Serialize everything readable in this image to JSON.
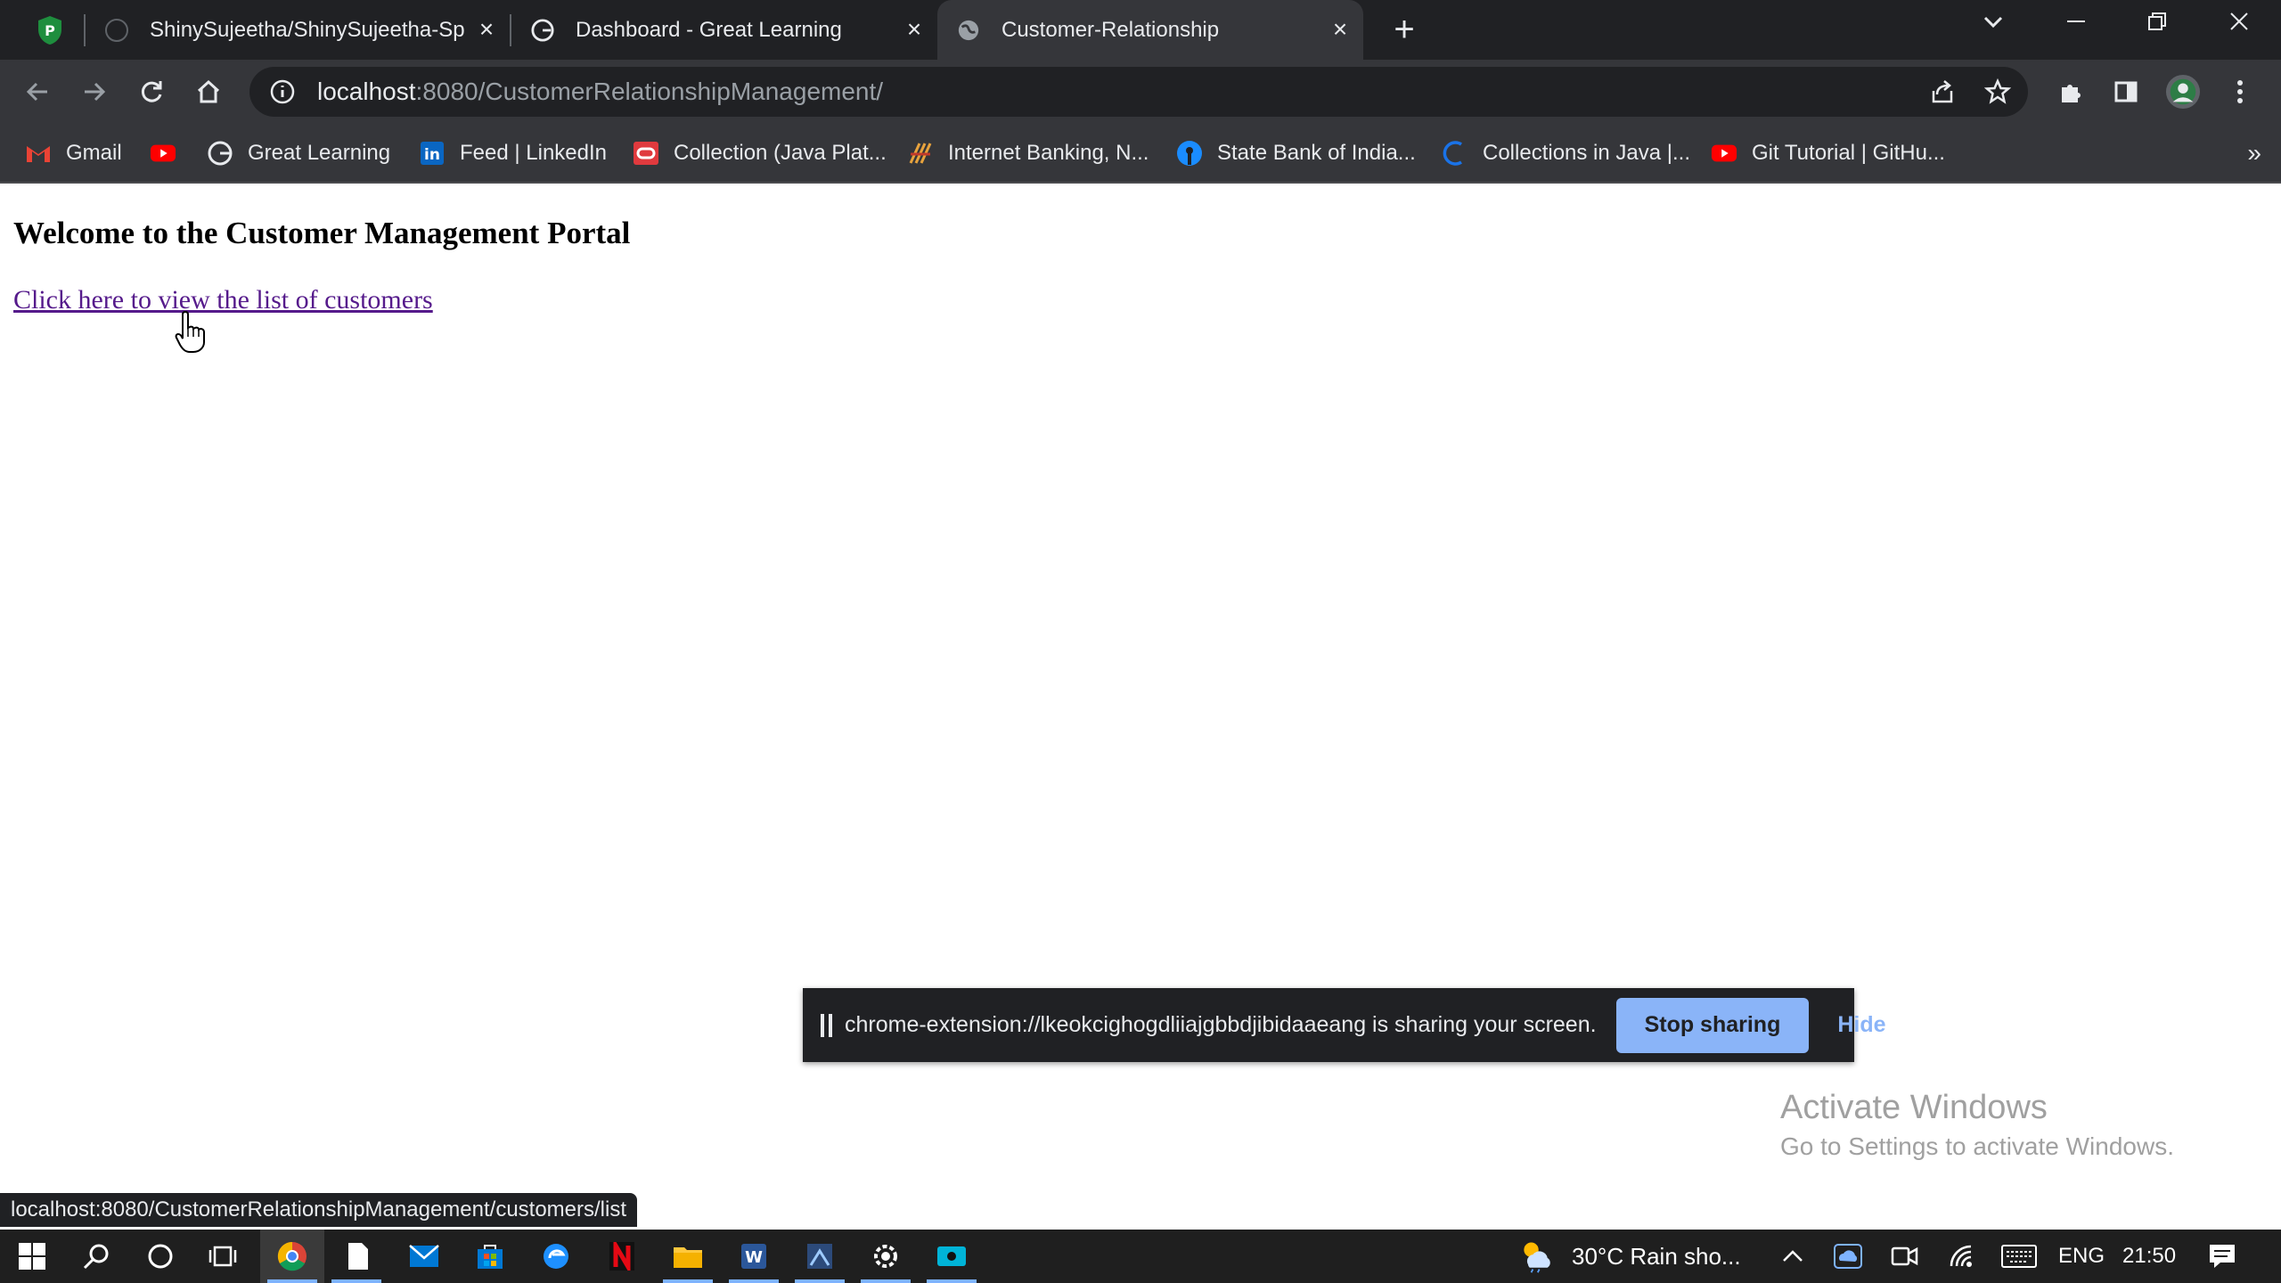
{
  "browser": {
    "tabs": [
      {
        "title": "ShinySujeetha/ShinySujeetha-Spr",
        "favicon": "github-icon"
      },
      {
        "title": "Dashboard - Great Learning",
        "favicon": "great-learning-icon"
      },
      {
        "title": "Customer-Relationship",
        "favicon": "globe-icon",
        "active": true
      }
    ],
    "url": {
      "host": "localhost",
      "path": ":8080/CustomerRelationshipManagement/"
    },
    "bookmarks": [
      {
        "label": "Gmail",
        "icon": "gmail-icon"
      },
      {
        "label": "",
        "icon": "youtube-icon"
      },
      {
        "label": "Great Learning",
        "icon": "great-learning-icon"
      },
      {
        "label": "Feed | LinkedIn",
        "icon": "linkedin-icon"
      },
      {
        "label": "Collection (Java Plat...",
        "icon": "oracle-icon"
      },
      {
        "label": "Internet Banking, N...",
        "icon": "bank-icon"
      },
      {
        "label": "State Bank of India...",
        "icon": "sbi-icon"
      },
      {
        "label": "Collections in Java |...",
        "icon": "loading-icon"
      },
      {
        "label": "Git Tutorial | GitHu...",
        "icon": "youtube-icon"
      }
    ]
  },
  "page": {
    "heading": "Welcome to the Customer Management Portal",
    "link_text": "Click here to view the list of customers"
  },
  "share_bar": {
    "text": "chrome-extension://lkeokcighogdliiajgbbdjibidaaeang is sharing your screen.",
    "stop_label": "Stop sharing",
    "hide_label": "Hide"
  },
  "watermark": {
    "title": "Activate Windows",
    "subtitle": "Go to Settings to activate Windows."
  },
  "status_bar": {
    "url": "localhost:8080/CustomerRelationshipManagement/customers/list"
  },
  "taskbar": {
    "weather": "30°C  Rain sho...",
    "language": "ENG",
    "time": "21:50"
  },
  "colors": {
    "chrome_dark": "#202124",
    "chrome_toolbar": "#35363a",
    "visited_link": "#551a8b",
    "stop_button": "#8ab4f8"
  }
}
